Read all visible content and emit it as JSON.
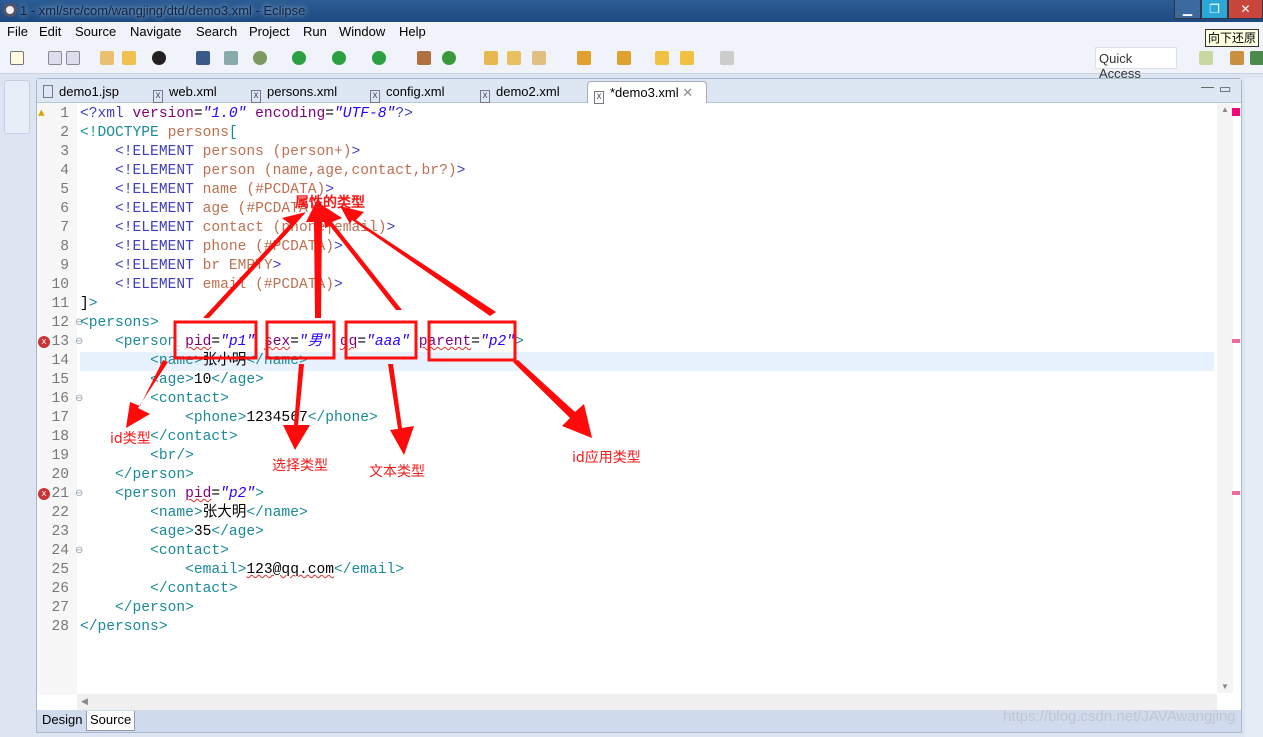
{
  "window": {
    "title": "1 - xml/src/com/wangjing/dtd/demo3.xml - Eclipse",
    "tooltip": "向下还原"
  },
  "menu": [
    "File",
    "Edit",
    "Source",
    "Navigate",
    "Search",
    "Project",
    "Run",
    "Window",
    "Help"
  ],
  "toolbar": {
    "quick_access": "Quick Access"
  },
  "tabs": [
    {
      "label": "demo1.jsp",
      "icon": "X"
    },
    {
      "label": "web.xml",
      "icon": "X"
    },
    {
      "label": "persons.xml",
      "icon": "X"
    },
    {
      "label": "config.xml",
      "icon": "X"
    },
    {
      "label": "demo2.xml",
      "icon": "X"
    },
    {
      "label": "*demo3.xml",
      "icon": "X",
      "active": true
    }
  ],
  "editor": {
    "lines": [
      [
        [
          "pi",
          "<?xml "
        ],
        [
          "an",
          "version"
        ],
        [
          "tx",
          "="
        ],
        [
          "av",
          "\"1.0\""
        ],
        [
          "an",
          " encoding"
        ],
        [
          "tx",
          "="
        ],
        [
          "av",
          "\"UTF-8\""
        ],
        [
          "pi",
          "?>"
        ]
      ],
      [
        [
          "tg",
          "<!DOCTYPE "
        ],
        [
          "nm",
          "persons"
        ],
        [
          "tg",
          "["
        ]
      ],
      [
        [
          "tx",
          "    "
        ],
        [
          "kw",
          "<!ELEMENT "
        ],
        [
          "nm",
          "persons (person+)"
        ],
        [
          "kw",
          ">"
        ]
      ],
      [
        [
          "tx",
          "    "
        ],
        [
          "kw",
          "<!ELEMENT "
        ],
        [
          "nm",
          "person (name,age,contact,br?)"
        ],
        [
          "kw",
          ">"
        ]
      ],
      [
        [
          "tx",
          "    "
        ],
        [
          "kw",
          "<!ELEMENT "
        ],
        [
          "nm",
          "name (#PCDATA)"
        ],
        [
          "kw",
          ">"
        ]
      ],
      [
        [
          "tx",
          "    "
        ],
        [
          "kw",
          "<!ELEMENT "
        ],
        [
          "nm",
          "age (#PCDATA)"
        ],
        [
          "kw",
          ">"
        ]
      ],
      [
        [
          "tx",
          "    "
        ],
        [
          "kw",
          "<!ELEMENT "
        ],
        [
          "nm",
          "contact (phone|email)"
        ],
        [
          "kw",
          ">"
        ]
      ],
      [
        [
          "tx",
          "    "
        ],
        [
          "kw",
          "<!ELEMENT "
        ],
        [
          "nm",
          "phone (#PCDATA)"
        ],
        [
          "kw",
          ">"
        ]
      ],
      [
        [
          "tx",
          "    "
        ],
        [
          "kw",
          "<!ELEMENT "
        ],
        [
          "nm",
          "br EMPTY"
        ],
        [
          "kw",
          ">"
        ]
      ],
      [
        [
          "tx",
          "    "
        ],
        [
          "kw",
          "<!ELEMENT "
        ],
        [
          "nm",
          "email (#PCDATA)"
        ],
        [
          "kw",
          ">"
        ]
      ],
      [
        [
          "tx",
          "]"
        ],
        [
          "tg",
          ">"
        ]
      ],
      [
        [
          "tg",
          "<persons>"
        ]
      ],
      [
        [
          "tx",
          "    "
        ],
        [
          "tg",
          "<person "
        ],
        [
          "an",
          "pid",
          "sq"
        ],
        [
          "tx",
          "="
        ],
        [
          "av",
          "\"p1\""
        ],
        [
          "tx",
          " "
        ],
        [
          "an",
          "sex",
          "sq"
        ],
        [
          "tx",
          "="
        ],
        [
          "av",
          "\"男\""
        ],
        [
          "tx",
          " "
        ],
        [
          "an",
          "qq",
          "sq"
        ],
        [
          "tx",
          "="
        ],
        [
          "av",
          "\"aaa\""
        ],
        [
          "tx",
          " "
        ],
        [
          "an",
          "parent",
          "sq"
        ],
        [
          "tx",
          "="
        ],
        [
          "av",
          "\"p2\""
        ],
        [
          "tg",
          ">"
        ]
      ],
      [
        [
          "tx",
          "        "
        ],
        [
          "tg",
          "<name>"
        ],
        [
          "tx",
          "张小明"
        ],
        [
          "tg",
          "</name>"
        ]
      ],
      [
        [
          "tx",
          "        "
        ],
        [
          "tg",
          "<age>"
        ],
        [
          "tx",
          "10"
        ],
        [
          "tg",
          "</age>"
        ]
      ],
      [
        [
          "tx",
          "        "
        ],
        [
          "tg",
          "<contact>"
        ]
      ],
      [
        [
          "tx",
          "            "
        ],
        [
          "tg",
          "<phone>"
        ],
        [
          "tx",
          "1234567"
        ],
        [
          "tg",
          "</phone>"
        ]
      ],
      [
        [
          "tx",
          "        "
        ],
        [
          "tg",
          "</contact>"
        ]
      ],
      [
        [
          "tx",
          "        "
        ],
        [
          "tg",
          "<br/>"
        ]
      ],
      [
        [
          "tx",
          "    "
        ],
        [
          "tg",
          "</person>"
        ]
      ],
      [
        [
          "tx",
          "    "
        ],
        [
          "tg",
          "<person "
        ],
        [
          "an",
          "pid",
          "sq"
        ],
        [
          "tx",
          "="
        ],
        [
          "av",
          "\"p2\""
        ],
        [
          "tg",
          ">"
        ]
      ],
      [
        [
          "tx",
          "        "
        ],
        [
          "tg",
          "<name>"
        ],
        [
          "tx",
          "张大明"
        ],
        [
          "tg",
          "</name>"
        ]
      ],
      [
        [
          "tx",
          "        "
        ],
        [
          "tg",
          "<age>"
        ],
        [
          "tx",
          "35"
        ],
        [
          "tg",
          "</age>"
        ]
      ],
      [
        [
          "tx",
          "        "
        ],
        [
          "tg",
          "<contact>"
        ]
      ],
      [
        [
          "tx",
          "            "
        ],
        [
          "tg",
          "<email>"
        ],
        [
          "tx",
          "123@qq.com",
          "sq"
        ],
        [
          "tg",
          "</email>"
        ]
      ],
      [
        [
          "tx",
          "        "
        ],
        [
          "tg",
          "</contact>"
        ]
      ],
      [
        [
          "tx",
          "    "
        ],
        [
          "tg",
          "</person>"
        ]
      ],
      [
        [
          "tg",
          "</persons>"
        ]
      ]
    ],
    "current_line": 14,
    "error_lines": [
      13,
      21
    ],
    "warning_lines": [
      1
    ],
    "fold_lines": [
      12,
      13,
      16,
      21,
      24
    ]
  },
  "bottom_tabs": [
    "Design",
    "Source"
  ],
  "active_bottom_tab": "Source",
  "annotations": {
    "attr_types": "属性的类型",
    "id_type": "id类型",
    "choice_type": "选择类型",
    "text_type": "文本类型",
    "idref_type": "id应用类型",
    "color": "#ff0000"
  },
  "watermark": "https://blog.csdn.net/JAVAwangjing"
}
